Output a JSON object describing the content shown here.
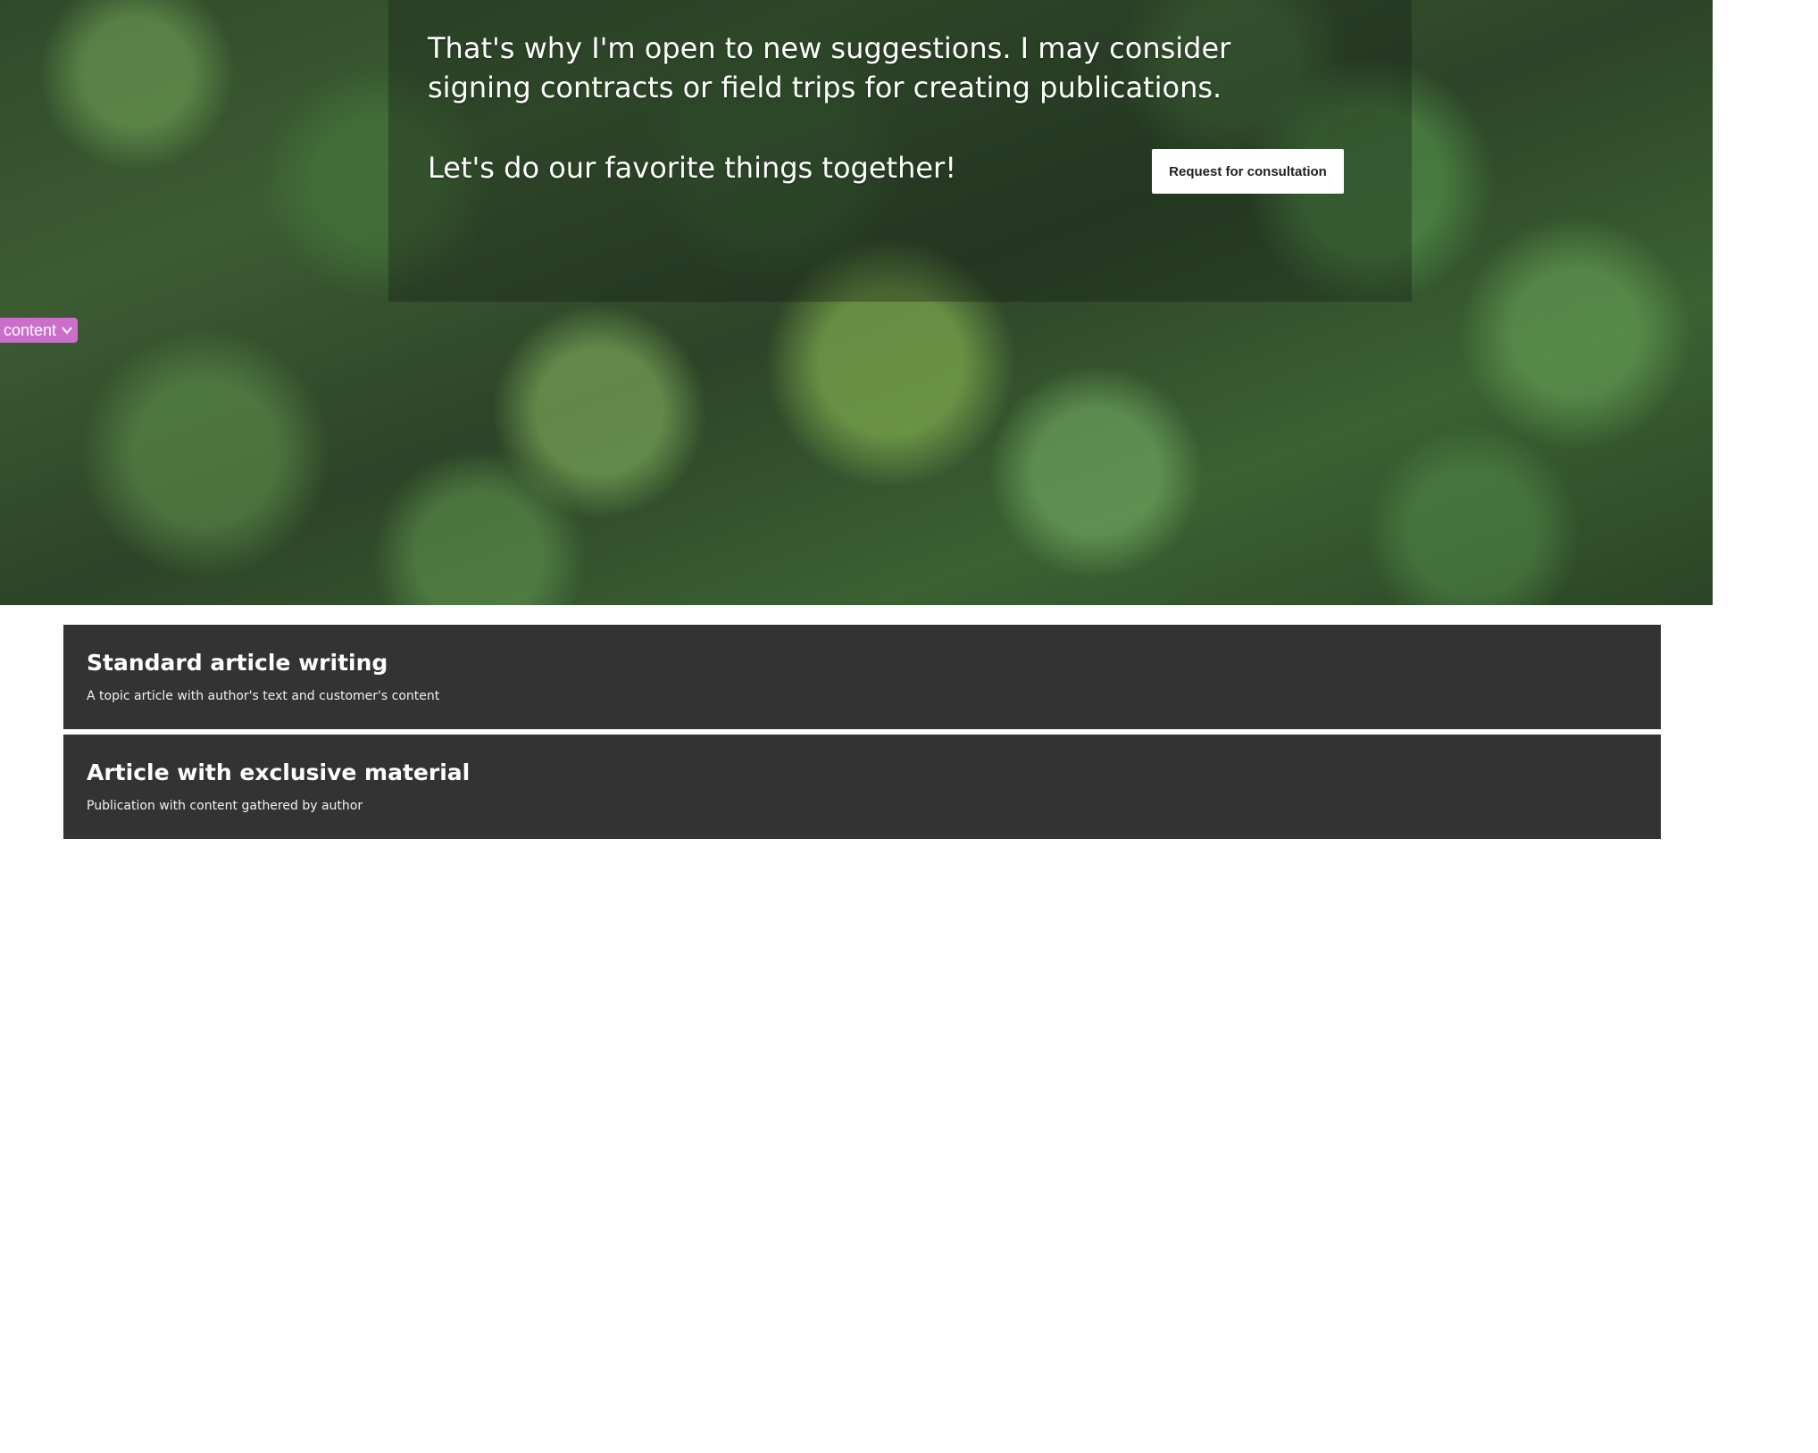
{
  "hero": {
    "paragraph": "That's why I'm open to new suggestions. I may consider signing contracts or field trips for creating publications.",
    "tagline": "Let's do our favorite things together!",
    "cta_label": "Request for consultation"
  },
  "content_tag": {
    "label": "content",
    "icon": "chevron-down-icon",
    "color": "#cc6ecc"
  },
  "services": [
    {
      "title": "Standard article writing",
      "description": "A topic article with author's text and customer's content"
    },
    {
      "title": "Article with exclusive material",
      "description": "Publication with content gathered by author"
    }
  ],
  "colors": {
    "card_background": "#333333",
    "cta_background": "#ffffff",
    "page_background": "#ffffff"
  }
}
